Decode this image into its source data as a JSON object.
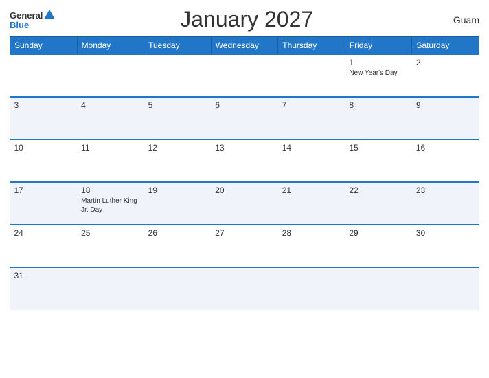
{
  "header": {
    "logo_general": "General",
    "logo_blue": "Blue",
    "title": "January 2027",
    "region": "Guam"
  },
  "calendar": {
    "days_of_week": [
      "Sunday",
      "Monday",
      "Tuesday",
      "Wednesday",
      "Thursday",
      "Friday",
      "Saturday"
    ],
    "weeks": [
      [
        {
          "day": "",
          "holiday": ""
        },
        {
          "day": "",
          "holiday": ""
        },
        {
          "day": "",
          "holiday": ""
        },
        {
          "day": "",
          "holiday": ""
        },
        {
          "day": "",
          "holiday": ""
        },
        {
          "day": "1",
          "holiday": "New Year's Day"
        },
        {
          "day": "2",
          "holiday": ""
        }
      ],
      [
        {
          "day": "3",
          "holiday": ""
        },
        {
          "day": "4",
          "holiday": ""
        },
        {
          "day": "5",
          "holiday": ""
        },
        {
          "day": "6",
          "holiday": ""
        },
        {
          "day": "7",
          "holiday": ""
        },
        {
          "day": "8",
          "holiday": ""
        },
        {
          "day": "9",
          "holiday": ""
        }
      ],
      [
        {
          "day": "10",
          "holiday": ""
        },
        {
          "day": "11",
          "holiday": ""
        },
        {
          "day": "12",
          "holiday": ""
        },
        {
          "day": "13",
          "holiday": ""
        },
        {
          "day": "14",
          "holiday": ""
        },
        {
          "day": "15",
          "holiday": ""
        },
        {
          "day": "16",
          "holiday": ""
        }
      ],
      [
        {
          "day": "17",
          "holiday": ""
        },
        {
          "day": "18",
          "holiday": "Martin Luther King Jr. Day"
        },
        {
          "day": "19",
          "holiday": ""
        },
        {
          "day": "20",
          "holiday": ""
        },
        {
          "day": "21",
          "holiday": ""
        },
        {
          "day": "22",
          "holiday": ""
        },
        {
          "day": "23",
          "holiday": ""
        }
      ],
      [
        {
          "day": "24",
          "holiday": ""
        },
        {
          "day": "25",
          "holiday": ""
        },
        {
          "day": "26",
          "holiday": ""
        },
        {
          "day": "27",
          "holiday": ""
        },
        {
          "day": "28",
          "holiday": ""
        },
        {
          "day": "29",
          "holiday": ""
        },
        {
          "day": "30",
          "holiday": ""
        }
      ],
      [
        {
          "day": "31",
          "holiday": ""
        },
        {
          "day": "",
          "holiday": ""
        },
        {
          "day": "",
          "holiday": ""
        },
        {
          "day": "",
          "holiday": ""
        },
        {
          "day": "",
          "holiday": ""
        },
        {
          "day": "",
          "holiday": ""
        },
        {
          "day": "",
          "holiday": ""
        }
      ]
    ]
  }
}
